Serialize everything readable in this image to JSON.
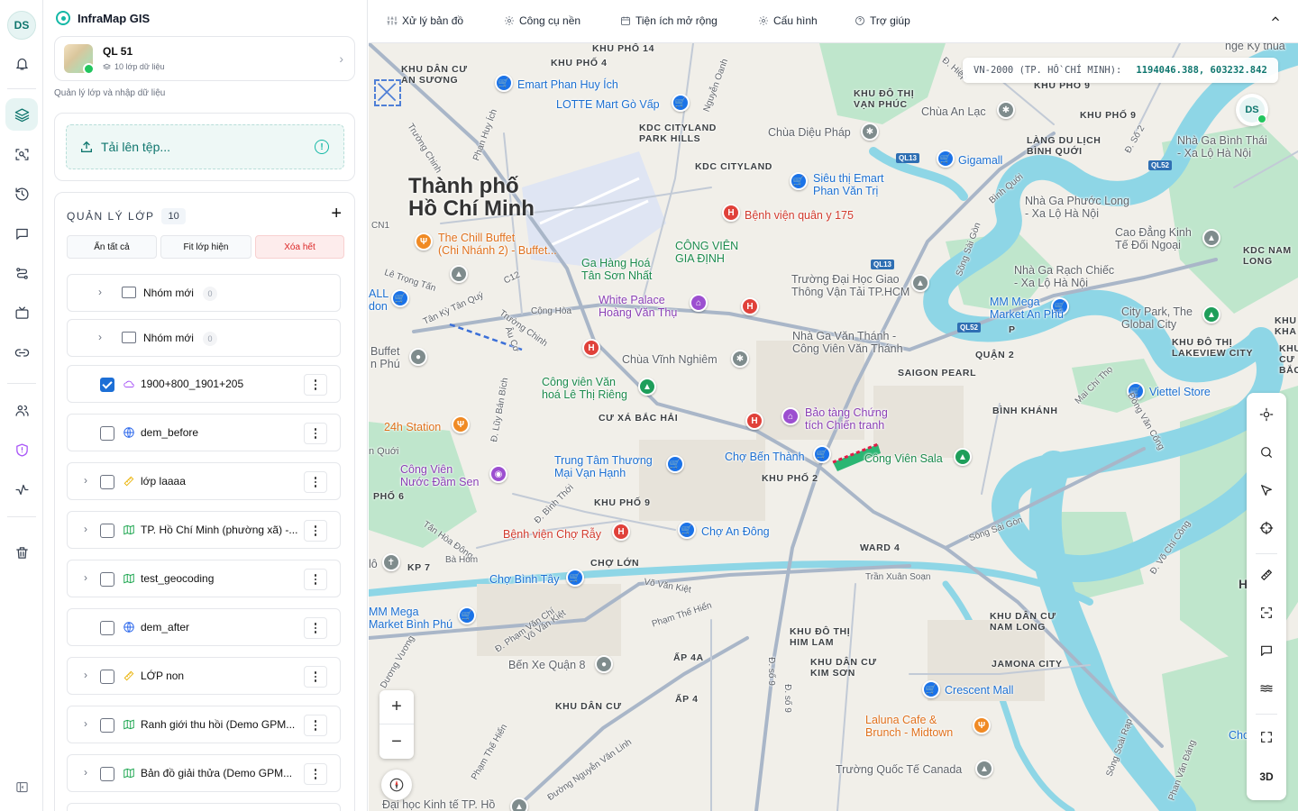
{
  "app": {
    "avatar_initials": "DS",
    "brand": "InfraMap GIS"
  },
  "project": {
    "name": "QL 51",
    "sub": "10 lớp dữ liệu",
    "caption": "Quản lý lớp và nhập dữ liệu"
  },
  "upload": {
    "label": "Tải lên tệp...",
    "info_icon": "!"
  },
  "layers": {
    "title": "QUẢN LÝ LỚP",
    "count": "10",
    "add": "+",
    "buttons": {
      "hide_all": "Ẩn tất cả",
      "fit": "Fit lớp hiện",
      "clear": "Xóa hết"
    },
    "groups": [
      {
        "label": "Nhóm mới",
        "count": "0"
      },
      {
        "label": "Nhóm mới",
        "count": "0"
      }
    ],
    "items": [
      {
        "label": "1900+800_1901+205",
        "checked": true,
        "icon": "cloud-icon",
        "expandable": false
      },
      {
        "label": "dem_before",
        "checked": false,
        "icon": "globe-icon",
        "expandable": false
      },
      {
        "label": "lớp laaaa",
        "checked": false,
        "icon": "ruler-icon",
        "expandable": true
      },
      {
        "label": "TP. Hồ Chí Minh (phường xã) -...",
        "checked": false,
        "icon": "map-icon",
        "expandable": true
      },
      {
        "label": "test_geocoding",
        "checked": false,
        "icon": "map-icon",
        "expandable": true
      },
      {
        "label": "dem_after",
        "checked": false,
        "icon": "globe-icon",
        "expandable": false
      },
      {
        "label": "LỚP non",
        "checked": false,
        "icon": "ruler-icon",
        "expandable": true
      },
      {
        "label": "Ranh giới thu hồi (Demo GPM...",
        "checked": false,
        "icon": "map-icon",
        "expandable": true
      },
      {
        "label": "Bản đồ giải thửa (Demo GPM...",
        "checked": false,
        "icon": "map-icon",
        "expandable": true
      }
    ]
  },
  "menu": [
    {
      "label": "Xử lý bản đồ",
      "icon": "sliders-icon"
    },
    {
      "label": "Công cụ nền",
      "icon": "gear-icon"
    },
    {
      "label": "Tiện ích mở rộng",
      "icon": "calendar-icon"
    },
    {
      "label": "Cấu hình",
      "icon": "gear-icon"
    },
    {
      "label": "Trợ giúp",
      "icon": "help-icon"
    }
  ],
  "coord": {
    "crs": "VN-2000 (TP. HỒ CHÍ MINH):",
    "value": "1194046.388, 603232.842"
  },
  "map": {
    "city": "Thành phố\nHồ Chí Minh",
    "toolbar_3d": "3D",
    "zoom_in": "+",
    "zoom_out": "−",
    "labels": {
      "l1": "KHU PHỐ 14",
      "l2": "KHU PHỐ 4",
      "l3": "KHU DÂN CƯ\nAN SƯƠNG",
      "l4": "Emart Phan Huy Ích",
      "l5": "LOTTE Mart Gò Vấp",
      "l6": "KDC CITYLAND\nPARK HILLS",
      "l7": "KDC CITYLAND",
      "l8": "KHU ĐÔ THỊ\nVẠN PHÚC",
      "l9": "Chùa An Lạc",
      "l10": "KHU PHỐ 9",
      "l11": "Chùa Diệu Pháp",
      "l12": "LÀNG DU LỊCH\nBÌNH QUỚI",
      "l13": "Nhà Ga Bình Thái\n- Xa Lộ Hà Nội",
      "l14": "Gigamall",
      "l15": "Siêu thị Emart\nPhan Văn Trị",
      "l16": "Bệnh viện quân y 175",
      "l17": "Nhà Ga Phước Long\n- Xa Lộ Hà Nội",
      "l18": "Cao Đẳng Kinh\nTế Đối Ngoại",
      "l19": "KDC NAM\nLONG",
      "l20": "The Chill Buffet\n(Chi Nhánh 2) - Buffet...",
      "l21": "CÔNG VIÊN\nGIA ĐỊNH",
      "l22": "Ga Hàng Hoá\nTân Sơn Nhất",
      "l23": "Trường Đại Học Giao\nThông Vận Tải TP.HCM",
      "l24": "Nhà Ga Rạch Chiếc\n- Xa Lộ Hà Nội",
      "l25": "MM Mega\nMarket An Phú",
      "l26": "City Park, The\nGlobal City",
      "l27": "KHU ĐÔ THỊ\nLAKEVIEW CITY",
      "l28": "White Palace\nHoàng Văn Thụ",
      "l29": "Nhà Ga Văn Thánh -\nCông Viên Văn Thánh",
      "l30": "QUẬN 2",
      "l31": "SAIGON PEARL",
      "l32": "Buffet\nn Phú",
      "l33": "Chùa Vĩnh Nghiêm",
      "l34": "Công viên Văn\nhoá Lê Thị Riêng",
      "l35": "BÌNH KHÁNH",
      "l36": "Viettel Store",
      "l37": "Bảo tàng Chứng\ntích Chiến tranh",
      "l38": "CƯ XÁ BẮC HẢI",
      "l39": "24h Station",
      "l40": "Công Viên\nNước Đầm Sen",
      "l41": "Trung Tâm Thương\nMại Vạn Hạnh",
      "l42": "Chợ Bến Thành",
      "l43": "Công Viên Sala",
      "l44": "KHU PHỐ 2",
      "l45": "KHU PHỐ 9",
      "l46": "Bệnh viện Chợ Rẫy",
      "l47": "Chợ An Đông",
      "l48": "WARD 4",
      "l49": "KP 7",
      "l50": "CHỢ LỚN",
      "l51": "Chợ Bình Tây",
      "l52": "MM Mega\nMarket Bình Phú",
      "l53": "KHU ĐÔ THỊ\nHIM LAM",
      "l54": "KHU DÂN CƯ\nNAM LONG",
      "l55": "Bến Xe Quận 8",
      "l56": "ẤP 4A",
      "l57": "KHU DÂN CƯ\nKIM SƠN",
      "l58": "JAMONA CITY",
      "l59": "Crescent Mall",
      "l60": "ẤP 4",
      "l61": "KHU DÂN CƯ",
      "l62": "Laluna Cafe &\nBrunch - Midtown",
      "l63": "Trường Quốc Tế Canada",
      "l64": "Đại học Kinh tế TP. Hồ",
      "l65": "KHU\nKHA",
      "l66": "KHU\nCƯ\nBẮC",
      "l67": "Cho",
      "l68": "ALL\ndon",
      "l69": "hge Ky thua",
      "l70": "KHU PHỐ 9",
      "l71": "P",
      "l72": "HỒ",
      "l73": "n Quới",
      "l74": "PHỐ 6",
      "l75": "lô"
    },
    "roads": {
      "r1": "Trường Chinh",
      "r2": "Phan Huy Ích",
      "r3": "Nguyễn Oanh",
      "r4": "Lê Trọng Tấn",
      "r5": "C12",
      "r6": "Tân Kỳ Tân Quý",
      "r7": "Cộng Hòa",
      "r8": "Trường Chinh",
      "r9": "Âu Cơ",
      "r10": "Đ. Lũy Bán Bích",
      "r11": "Đ. Bình Thới",
      "r12": "Tân Hòa Đông",
      "r13": "Bà Hom",
      "r14": "Võ Văn Kiệt",
      "r15": "Phạm Thế Hiển",
      "r16": "Trần Xuân Soạn",
      "r17": "Sông Sài Gòn",
      "r18": "Sông Sài Gòn",
      "r19": "Đồng Văn Cống",
      "r20": "Mai Chí Thọ",
      "r21": "Đ. Võ Chí Công",
      "r22": "Bình Quới",
      "r23": "Đ. Số 2",
      "r24": "Đ. Hiệp",
      "r25": "Sông Soài Rạp",
      "r26": "Phan Văn Đáng",
      "r27": "Đường Nguyễn Văn Linh",
      "r28": "Phạm Thế Hiển",
      "r29": "Dương Vương",
      "r30": "Đ. Phạm Văn Chí",
      "r31": "Võ Văn Kiệt",
      "r32": "Đ. số 9",
      "r33": "CN1",
      "r34": "QL13",
      "r35": "QL13",
      "r36": "QL52",
      "r37": "QL52",
      "r38": "Đ. số 9"
    }
  },
  "colors": {
    "accent": "#0f766e",
    "accent_bg": "#e6f4f3",
    "danger": "#dc2626",
    "water": "#7fd3e3",
    "park": "#b9e3c6"
  }
}
